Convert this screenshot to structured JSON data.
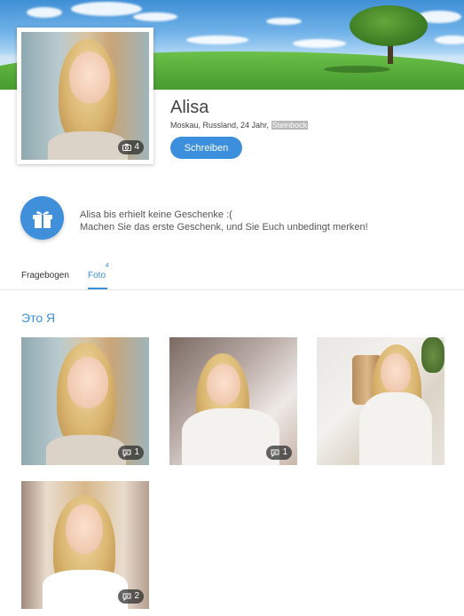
{
  "profile": {
    "name": "Alisa",
    "meta_prefix": "Moskau, Russland, 24 Jahr, ",
    "meta_highlight": "Steinbock",
    "avatar_photo_count": "4",
    "write_button": "Schreiben"
  },
  "gifts": {
    "line1": "Alisa bis erhielt keine Geschenke :(",
    "line2": "Machen Sie das erste Geschenk, und Sie Euch unbedingt merken!",
    "icon": "gift-icon"
  },
  "tabs": [
    {
      "label": "Fragebogen",
      "count": ""
    },
    {
      "label": "Foto",
      "count": "4"
    }
  ],
  "album": {
    "title": "Это Я",
    "photos": [
      {
        "comments": "1"
      },
      {
        "comments": "1"
      },
      {
        "comments": ""
      },
      {
        "comments": "2"
      }
    ]
  },
  "colors": {
    "accent": "#3c8fdc"
  }
}
